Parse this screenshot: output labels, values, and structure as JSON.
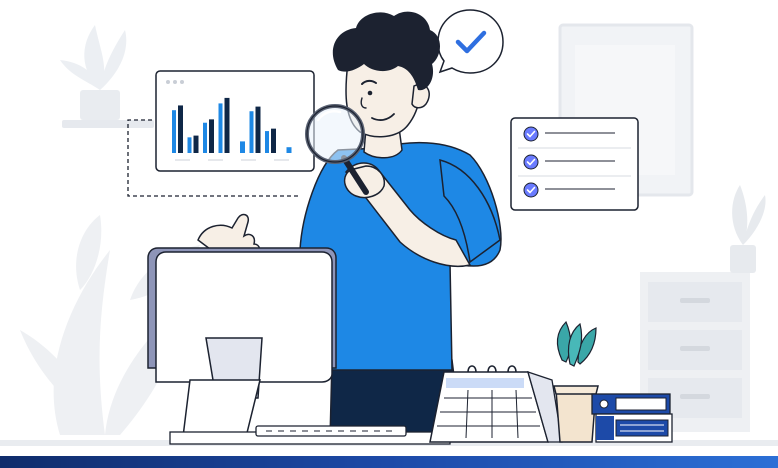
{
  "illustration": {
    "subject": "person-inspecting-with-magnifying-glass",
    "colors": {
      "accent_blue": "#1e88e5",
      "deep_blue": "#1d4aa8",
      "check_blue": "#2f6fe0",
      "task_purple": "#6a7bff",
      "navy": "#0f2747",
      "outline": "#1c2230",
      "skin": "#f7efe6",
      "light_gray": "#eef0f3",
      "mid_gray": "#d9dde3"
    },
    "mini_chart": {
      "bars": [
        {
          "dark": 0.82,
          "light": 0.0
        },
        {
          "dark": 0.3,
          "light": 0.0
        },
        {
          "dark": 0.58,
          "light": 0.0
        },
        {
          "dark": 0.95,
          "light": 0.0
        },
        {
          "dark": 0.0,
          "light": 0.2
        },
        {
          "dark": 0.8,
          "light": 0.0
        },
        {
          "dark": 0.42,
          "light": 0.0
        },
        {
          "dark": 0.0,
          "light": 0.1
        }
      ]
    },
    "checklist_items": 3,
    "icons": [
      "check-icon",
      "magnifying-glass-icon",
      "calendar-icon",
      "monitor-icon",
      "plant-icon"
    ]
  }
}
